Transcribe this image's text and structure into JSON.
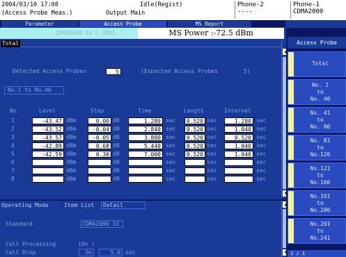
{
  "header": {
    "datetime": "2004/03/10 17:08",
    "screen_name": "(Access Probe Meas.)",
    "mode": "Output Main",
    "status": "Idle(Regist)",
    "phone2_label": "Phone-2",
    "phone2_value": "----",
    "phone1_label": "Phone-1",
    "phone1_value": "CDMA2000"
  },
  "tabs": [
    "Parameter",
    "Access Probe",
    "MS Report"
  ],
  "status_bar": {
    "system": "CDMA2000 1X : RBS5",
    "ms_power": "MS Power :-72.5 dBm"
  },
  "main": {
    "section_label": "Total",
    "detected_label": "Detected Access Probes",
    "detected_value": "5",
    "expected_label": "(Expected Access Probes",
    "expected_value": "5)",
    "range_button": "No.1 to No.40",
    "columns": [
      "No.",
      "Level",
      "Step",
      "Time",
      "Length",
      "Interval"
    ],
    "units": {
      "level": "dBm",
      "step": "dB",
      "time": "sec",
      "length": "sec",
      "interval": "sec"
    },
    "rows": [
      {
        "no": "1",
        "level": "-43.47",
        "step": "0.00",
        "time": "1.280",
        "length": "0.520",
        "interval": "1.280"
      },
      {
        "no": "2",
        "level": "-43.52",
        "step": "-0.04",
        "time": "2.840",
        "length": "0.520",
        "interval": "1.040"
      },
      {
        "no": "3",
        "level": "-43.57",
        "step": "-0.05",
        "time": "3.880",
        "length": "0.520",
        "interval": "0.520"
      },
      {
        "no": "4",
        "level": "-42.89",
        "step": "0.68",
        "time": "5.440",
        "length": "0.520",
        "interval": "1.040"
      },
      {
        "no": "5",
        "level": "-42.59",
        "step": "0.30",
        "time": "7.000",
        "length": "0.520",
        "interval": "1.040"
      },
      {
        "no": "6",
        "level": "",
        "step": "",
        "time": "",
        "length": "",
        "interval": ""
      },
      {
        "no": "7",
        "level": "",
        "step": "",
        "time": "",
        "length": "",
        "interval": ""
      },
      {
        "no": "8",
        "level": "",
        "step": "",
        "time": "",
        "length": "",
        "interval": ""
      }
    ]
  },
  "lower": {
    "operating_mode": "Operating Mode",
    "item_list_label": "Item List",
    "item_list_value": "Detail",
    "standard_label": "Standard",
    "standard_value": "CDMA2000 1X",
    "call_processing_label": "Call Processing",
    "call_processing_value": "(On )",
    "call_drop_label": "Call Drop",
    "call_drop_value": "On",
    "call_drop_time": "5.0",
    "call_drop_unit": "sec"
  },
  "side": {
    "title": "Access Probe",
    "buttons": [
      "Total",
      "No. 1\nto\nNo. 40",
      "No. 41\nto\nNo. 80",
      "No. 81\nto\nNo.120",
      "No.121\nto\nNo.160",
      "No.161\nto\nNo.200",
      "No.201\nto\nNo.241"
    ],
    "page": "1 / 1"
  }
}
